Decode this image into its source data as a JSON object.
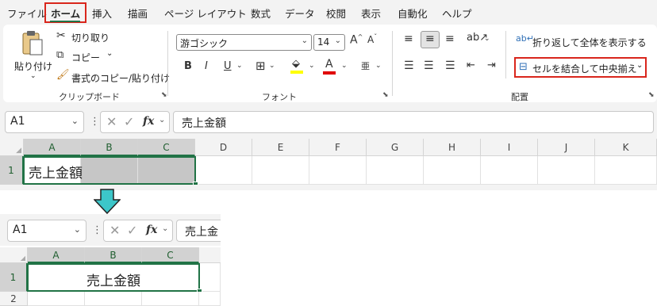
{
  "menu": {
    "items": [
      "ファイル",
      "ホーム",
      "挿入",
      "描画",
      "ページ レイアウト",
      "数式",
      "データ",
      "校閲",
      "表示",
      "自動化",
      "ヘルプ"
    ],
    "active": "ホーム"
  },
  "ribbon": {
    "clipboard": {
      "paste_label": "貼り付け",
      "cut_label": "切り取り",
      "copy_label": "コピー",
      "format_painter_label": "書式のコピー/貼り付け",
      "group_label": "クリップボード"
    },
    "font": {
      "font_name": "游ゴシック",
      "font_size": "14",
      "bold": "B",
      "italic": "I",
      "underline": "U",
      "font_color_letter": "A",
      "group_label": "フォント"
    },
    "alignment": {
      "wrap_text_label": "折り返して全体を表示する",
      "merge_center_label": "セルを結合して中央揃え",
      "group_label": "配置"
    }
  },
  "formula_bar_top": {
    "name_box": "A1",
    "formula": "売上金額"
  },
  "sheet_top": {
    "columns": [
      "A",
      "B",
      "C",
      "D",
      "E",
      "F",
      "G",
      "H",
      "I",
      "J",
      "K"
    ],
    "rows": [
      "1"
    ],
    "a1_value": "売上金額"
  },
  "formula_bar_bottom": {
    "name_box": "A1",
    "formula": "売上金"
  },
  "sheet_bottom": {
    "columns": [
      "A",
      "B",
      "C"
    ],
    "rows": [
      "1",
      "2"
    ],
    "merged_value": "売上金額"
  },
  "colors": {
    "highlight": "#d9261c",
    "selection": "#217346",
    "arrow": "#3cc6c9"
  }
}
